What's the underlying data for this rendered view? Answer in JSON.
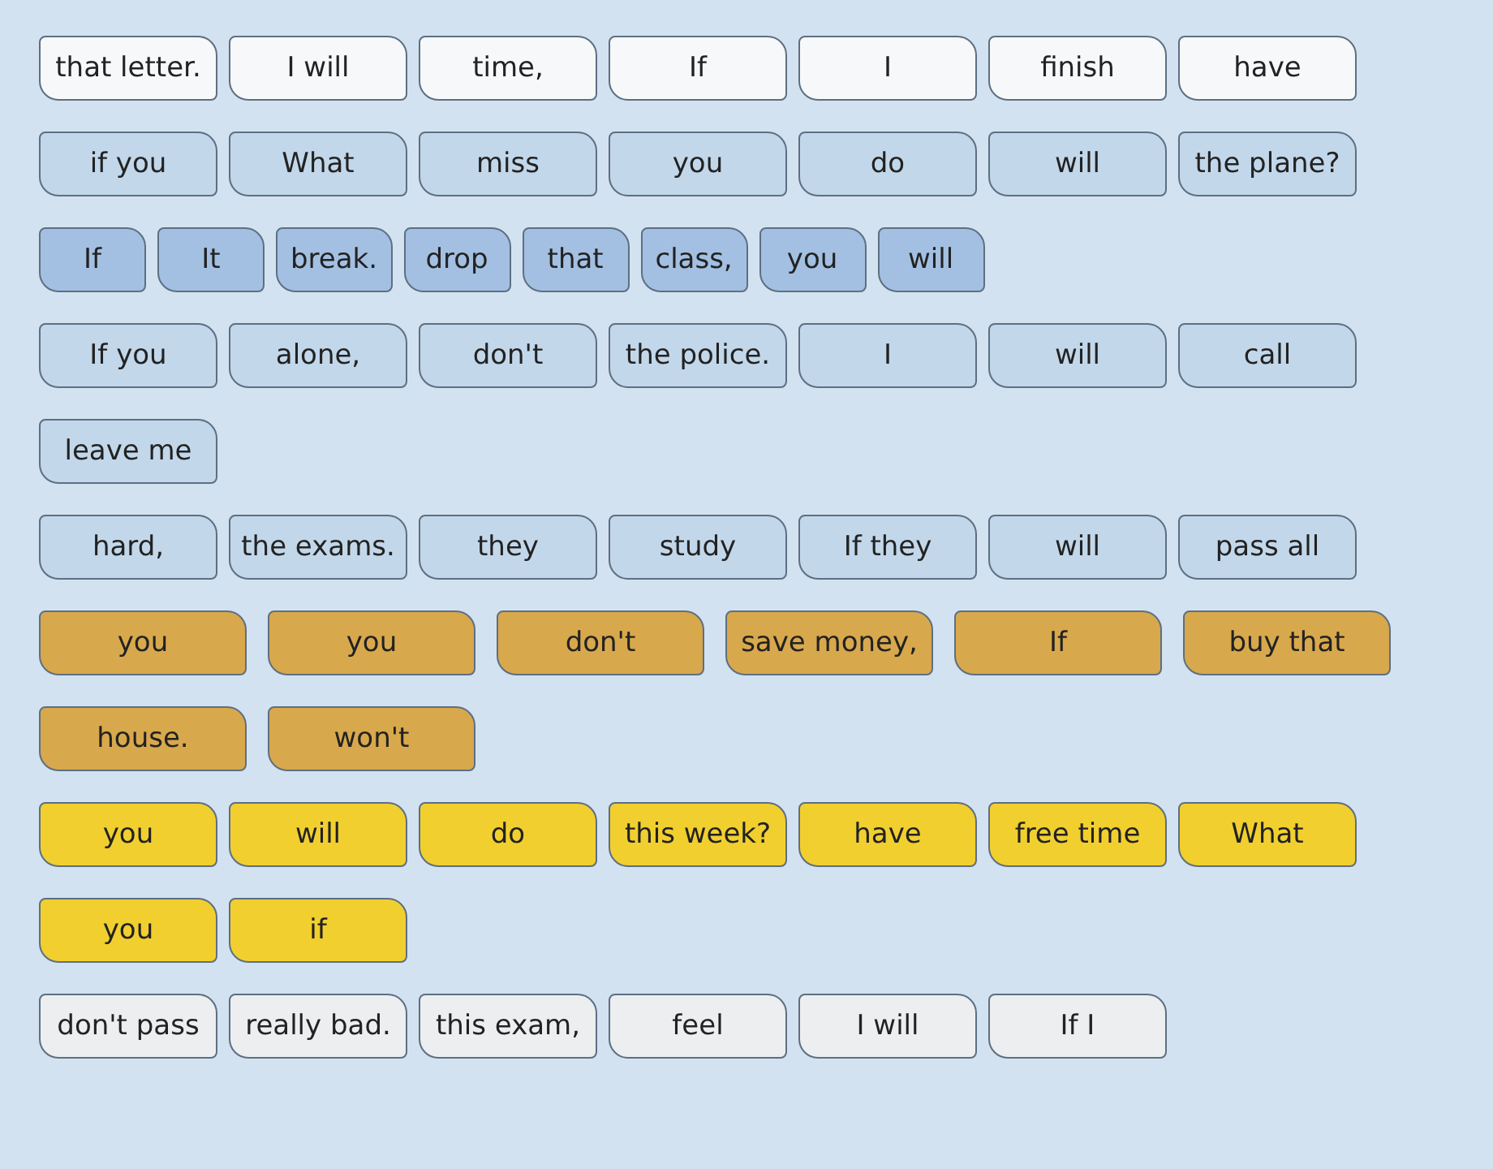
{
  "rows": [
    {
      "color": "#f6f8fa",
      "kind": "wide",
      "tiles": [
        "that letter.",
        "I will",
        "time,",
        "If",
        "I",
        "finish",
        "have"
      ]
    },
    {
      "color": "#c2d7ea",
      "kind": "wide",
      "tiles": [
        "if you",
        "What",
        "miss",
        "you",
        "do",
        "will",
        "the plane?"
      ]
    },
    {
      "color": "#a3c0e2",
      "kind": "compact",
      "tiles": [
        "If",
        "It",
        "break.",
        "drop",
        "that",
        "class,",
        "you",
        "will"
      ]
    },
    {
      "color": "#c2d7ea",
      "kind": "wide",
      "tiles": [
        "If you",
        "alone,",
        "don't",
        "the police.",
        "I",
        "will",
        "call"
      ]
    },
    {
      "color": "#c2d7ea",
      "kind": "wide",
      "tiles": [
        "leave me"
      ]
    },
    {
      "color": "#c2d7ea",
      "kind": "wide",
      "tiles": [
        "hard,",
        "the exams.",
        "they",
        "study",
        "If they",
        "will",
        "pass all"
      ]
    },
    {
      "color": "#d8a84c",
      "kind": "large",
      "tiles": [
        "you",
        "you",
        "don't",
        "save money,",
        "If",
        "buy that"
      ]
    },
    {
      "color": "#d8a84c",
      "kind": "large",
      "tiles": [
        "house.",
        "won't"
      ]
    },
    {
      "color": "#f1cf2f",
      "kind": "wide",
      "tiles": [
        "you",
        "will",
        "do",
        "this week?",
        "have",
        "free time",
        "What"
      ]
    },
    {
      "color": "#f1cf2f",
      "kind": "wide",
      "tiles": [
        "you",
        "if"
      ]
    },
    {
      "color": "#eceef0",
      "kind": "wide",
      "tiles": [
        "don't pass",
        "really bad.",
        "this exam,",
        "feel",
        "I will",
        "If I"
      ]
    }
  ]
}
